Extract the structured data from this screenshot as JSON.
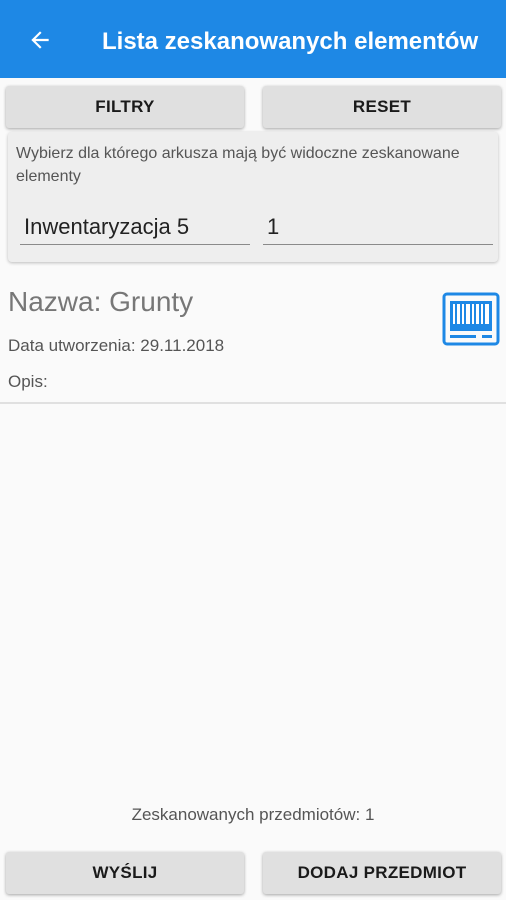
{
  "appbar": {
    "title": "Lista zeskanowanych elementów",
    "background": "#1e88e5",
    "back_icon": "arrow-back-icon"
  },
  "toolbar": {
    "filter_label": "FILTRY",
    "reset_label": "RESET"
  },
  "filter": {
    "hint": "Wybierz dla którego arkusza mają być widoczne zeskanowane elementy",
    "sheet_value": "Inwentaryzacja 5",
    "number_value": "1"
  },
  "items": [
    {
      "name": "Nazwa: Grunty",
      "created": "Data utworzenia: 29.11.2018",
      "description": "Opis:",
      "icon": "barcode-scanner-icon"
    }
  ],
  "footer": {
    "count_text": "Zeskanowanych przedmiotów: 1",
    "send_label": "WYŚLIJ",
    "add_label": "DODAJ PRZEDMIOT"
  },
  "colors": {
    "accent": "#1e88e5",
    "button_bg": "#e0e0e0"
  }
}
